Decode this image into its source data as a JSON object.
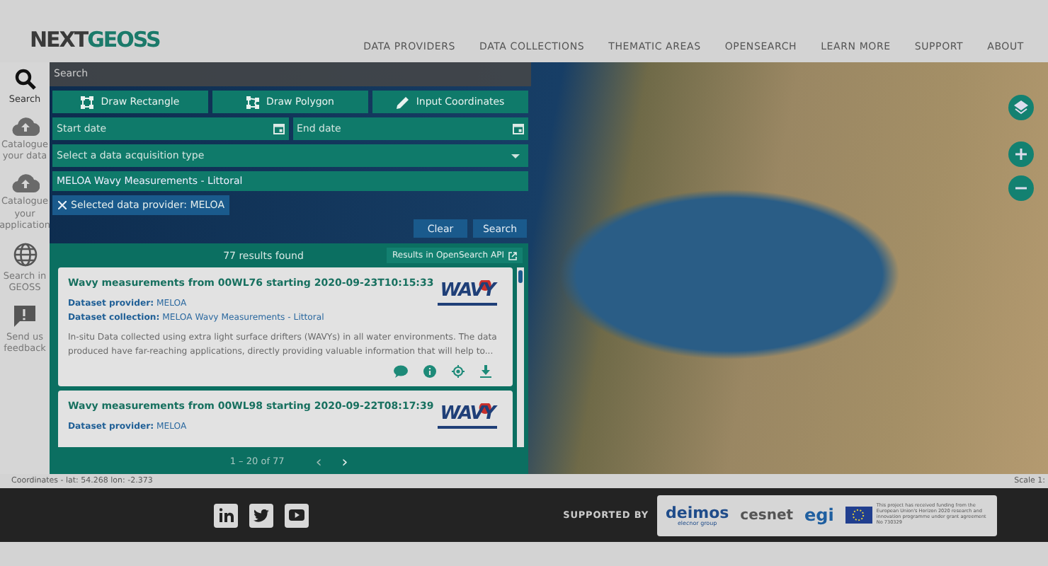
{
  "header": {
    "logo": {
      "dark": "NEXT",
      "teal": "GEOSS"
    },
    "nav": [
      "DATA PROVIDERS",
      "DATA COLLECTIONS",
      "THEMATIC AREAS",
      "OPENSEARCH",
      "LEARN MORE",
      "SUPPORT",
      "ABOUT"
    ]
  },
  "sidebar": {
    "items": [
      {
        "label": "Search",
        "selected": true
      },
      {
        "label": "Catalogue your data",
        "selected": false
      },
      {
        "label": "Catalogue your application",
        "selected": false
      },
      {
        "label": "Search in GEOSS",
        "selected": false
      },
      {
        "label": "Send us feedback",
        "selected": false
      }
    ]
  },
  "search_panel": {
    "title": "Search",
    "draw_buttons": [
      "Draw Rectangle",
      "Draw Polygon",
      "Input Coordinates"
    ],
    "start_date": {
      "placeholder": "Start date"
    },
    "end_date": {
      "placeholder": "End date"
    },
    "acquisition_type": {
      "placeholder": "Select a data acquisition type"
    },
    "collection": "MELOA Wavy Measurements - Littoral",
    "filter_chip": "Selected data provider: MELOA",
    "buttons": [
      "Clear",
      "Search"
    ]
  },
  "results": {
    "count": "77 results found",
    "api_link": "Results in OpenSearch API",
    "items": [
      {
        "title": "Wavy measurements from 00WL76 starting 2020-09-23T10:15:33",
        "provider_label": "Dataset provider:",
        "provider": "MELOA",
        "collection_label": "Dataset collection:",
        "collection": "MELOA Wavy Measurements - Littoral",
        "description": "In-situ Data collected using extra light surface drifters (WAVYs) in all water environments. The data produced have far-reaching applications, directly providing valuable information that will help to...",
        "logo": "WAVY"
      },
      {
        "title": "Wavy measurements from 00WL98 starting 2020-09-22T08:17:39",
        "provider_label": "Dataset provider:",
        "provider": "MELOA",
        "logo": "WAVY"
      }
    ],
    "pagination": {
      "range": "1 – 20 of 77",
      "prev": "‹",
      "next": "›"
    }
  },
  "status_bar": {
    "coordinates": "Coordinates - lat: 54.268 lon: -2.373",
    "scale": "Scale 1:"
  },
  "footer": {
    "supported_by": "SUPPORTED BY",
    "sponsors": [
      {
        "kind": "deimos",
        "name": "deimos",
        "sub": "elecnor group"
      },
      {
        "kind": "cesnet",
        "name": "cesnet"
      },
      {
        "kind": "egi",
        "name": "egi"
      },
      {
        "kind": "eu",
        "name": "This project has received funding from the European Union's Horizon 2020 research and innovation programme under grant agreement No 730329"
      }
    ]
  }
}
